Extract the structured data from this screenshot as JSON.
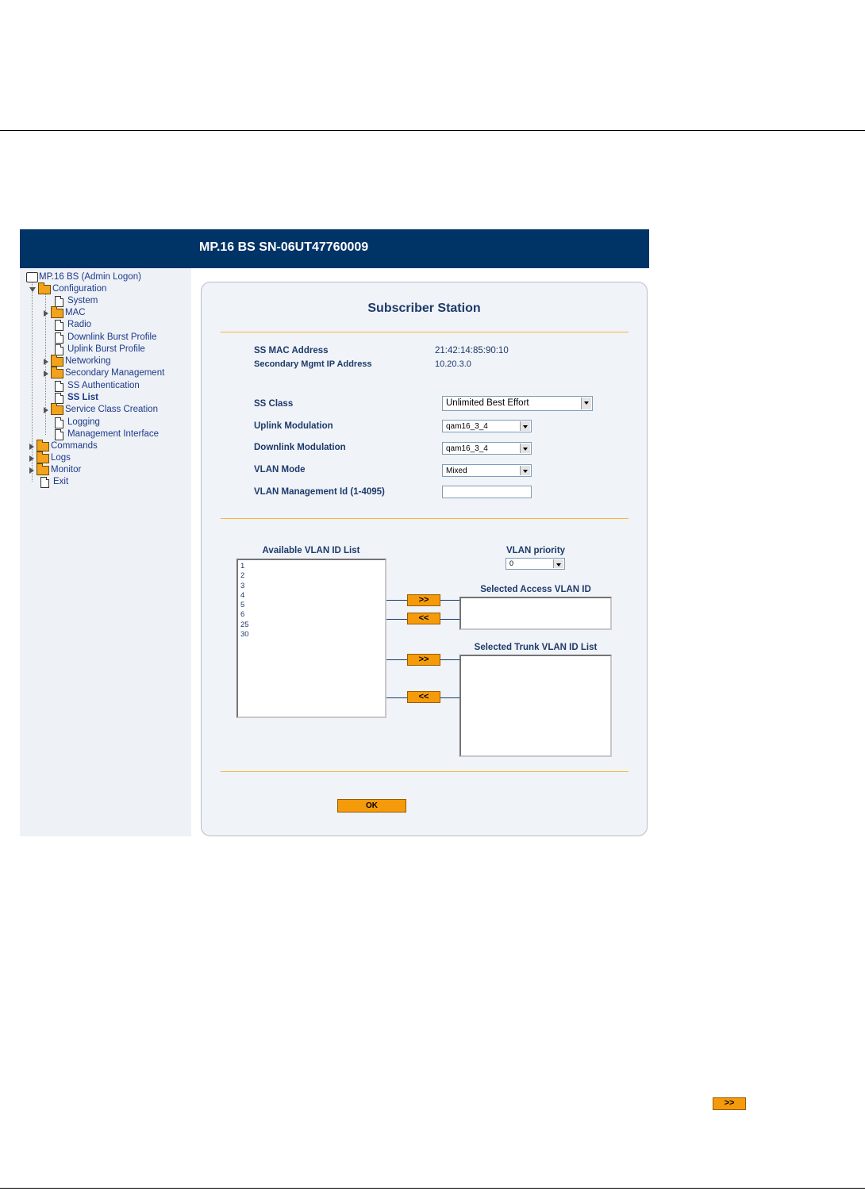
{
  "app": {
    "banner_title": "MP.16 BS SN-06UT47760009"
  },
  "nav": {
    "root": "MP.16 BS (Admin Logon)",
    "configuration": "Configuration",
    "system": "System",
    "mac": "MAC",
    "radio": "Radio",
    "downlink_burst_profile": "Downlink Burst Profile",
    "uplink_burst_profile": "Uplink Burst Profile",
    "networking": "Networking",
    "secondary_management": "Secondary Management",
    "ss_authentication": "SS Authentication",
    "ss_list": "SS List",
    "service_class_creation": "Service Class Creation",
    "logging": "Logging",
    "management_interface": "Management Interface",
    "commands": "Commands",
    "logs": "Logs",
    "monitor": "Monitor",
    "exit": "Exit"
  },
  "form": {
    "title": "Subscriber Station",
    "ss_mac_label": "SS MAC Address",
    "ss_mac_value": "21:42:14:85:90:10",
    "sec_ip_label": "Secondary Mgmt IP Address",
    "sec_ip_value": "10.20.3.0",
    "ss_class_label": "SS Class",
    "ss_class_value": "Unlimited Best Effort",
    "uplink_mod_label": "Uplink Modulation",
    "uplink_mod_value": "qam16_3_4",
    "downlink_mod_label": "Downlink Modulation",
    "downlink_mod_value": "qam16_3_4",
    "vlan_mode_label": "VLAN Mode",
    "vlan_mode_value": "Mixed",
    "vlan_mgmt_label": "VLAN Management Id (1-4095)",
    "vlan_mgmt_value": ""
  },
  "vlan": {
    "available_title": "Available VLAN ID List",
    "available_items": [
      "1",
      "2",
      "3",
      "4",
      "5",
      "6",
      "25",
      "30"
    ],
    "priority_label": "VLAN priority",
    "priority_value": "0",
    "access_title": "Selected Access VLAN ID",
    "trunk_title": "Selected Trunk VLAN ID List",
    "add_label": ">>",
    "remove_label": "<<"
  },
  "ok_label": "OK",
  "footer_button_label": ">>"
}
